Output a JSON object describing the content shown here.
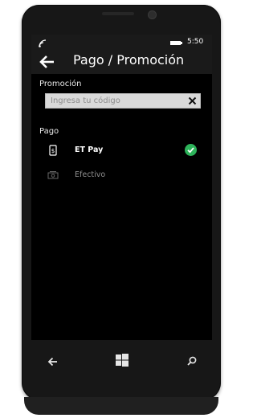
{
  "status_bar": {
    "time": "5:50"
  },
  "header": {
    "title": "Pago / Promoción"
  },
  "promotion": {
    "section_label": "Promoción",
    "input_value": "",
    "input_placeholder": "Ingresa tu código"
  },
  "payment": {
    "section_label": "Pago",
    "methods": [
      {
        "label": "ET Pay",
        "icon": "phone-payment-icon",
        "selected": true
      },
      {
        "label": "Efectivo",
        "icon": "cash-icon",
        "selected": false
      }
    ]
  },
  "colors": {
    "check": "#2db35a",
    "background": "#000000",
    "input_bg": "#d9d9d9"
  }
}
